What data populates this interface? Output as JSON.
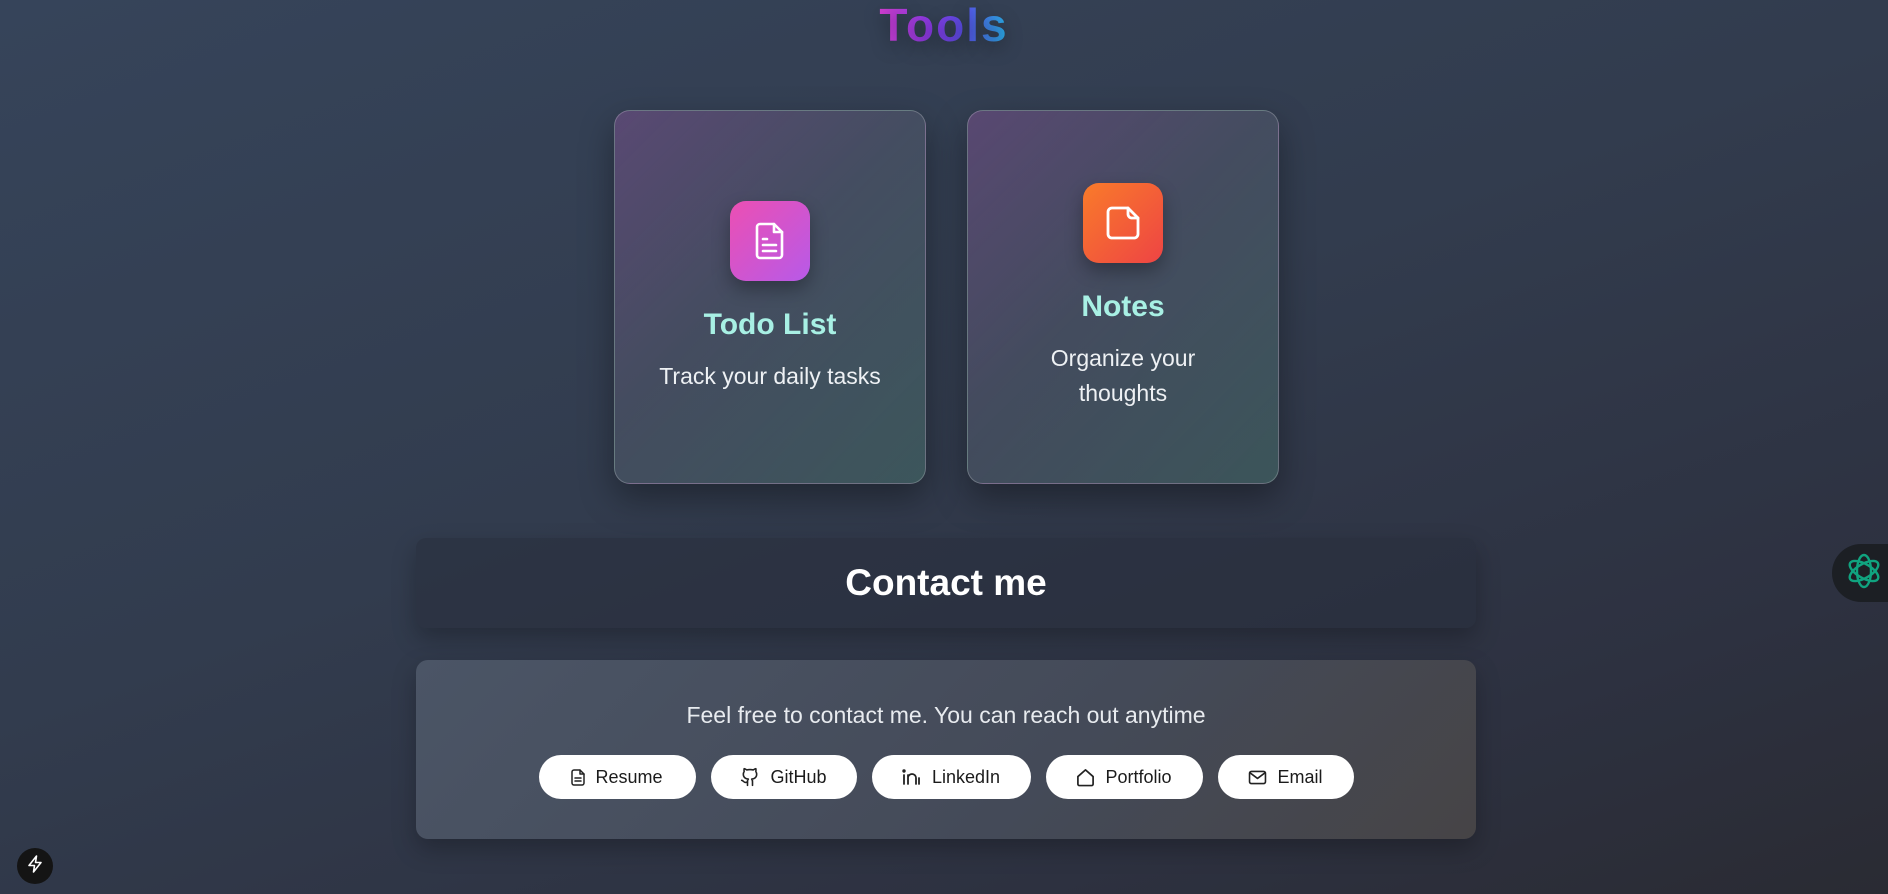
{
  "page": {
    "title": "Tools"
  },
  "tools": [
    {
      "name": "Todo List",
      "description": "Track your daily tasks",
      "icon": "document-lines-icon"
    },
    {
      "name": "Notes",
      "description": "Organize your thoughts",
      "icon": "note-icon"
    }
  ],
  "contact": {
    "title": "Contact me",
    "message": "Feel free to contact me. You can reach out anytime",
    "links": [
      {
        "label": "Resume",
        "icon": "file-icon"
      },
      {
        "label": "GitHub",
        "icon": "github-icon"
      },
      {
        "label": "LinkedIn",
        "icon": "linkedin-icon"
      },
      {
        "label": "Portfolio",
        "icon": "home-icon"
      },
      {
        "label": "Email",
        "icon": "mail-icon"
      }
    ]
  },
  "colors": {
    "title_gradient": [
      "#d53fd4",
      "#8b3be8",
      "#27b1e6"
    ],
    "tool_name": "#a8f0e4",
    "todo_icon_bg": "#ec4fb3",
    "notes_icon_bg": "#f97b2a",
    "ai_accent": "#10a37f"
  },
  "widgets": {
    "side_tab_icon": "openai-logo-icon",
    "corner_badge_icon": "lightning-bolt-icon"
  }
}
